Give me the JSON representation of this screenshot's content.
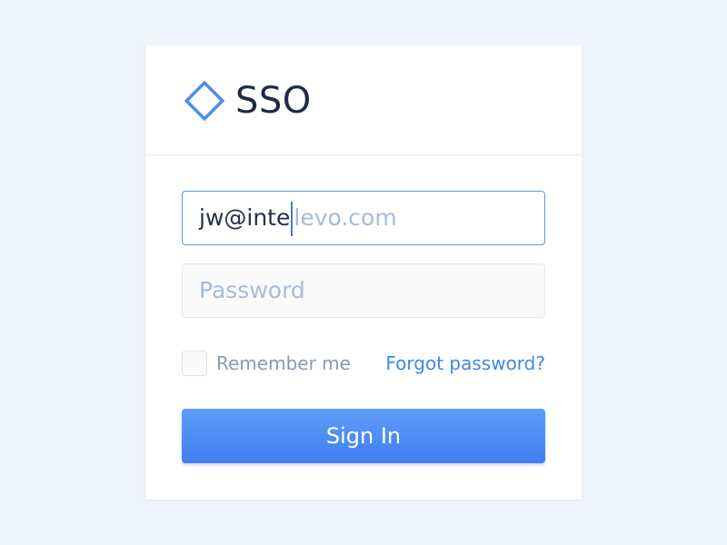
{
  "brand": {
    "name": "SSO",
    "icon": "diamond-outline-icon",
    "accent_color": "#4a8cf0"
  },
  "login_form": {
    "email": {
      "typed_value": "jw@inte",
      "autocomplete_suggestion": "levo.com"
    },
    "password": {
      "placeholder": "Password",
      "value": ""
    },
    "remember_me": {
      "label": "Remember me",
      "checked": false
    },
    "forgot_password_label": "Forgot password?",
    "submit_label": "Sign In"
  }
}
